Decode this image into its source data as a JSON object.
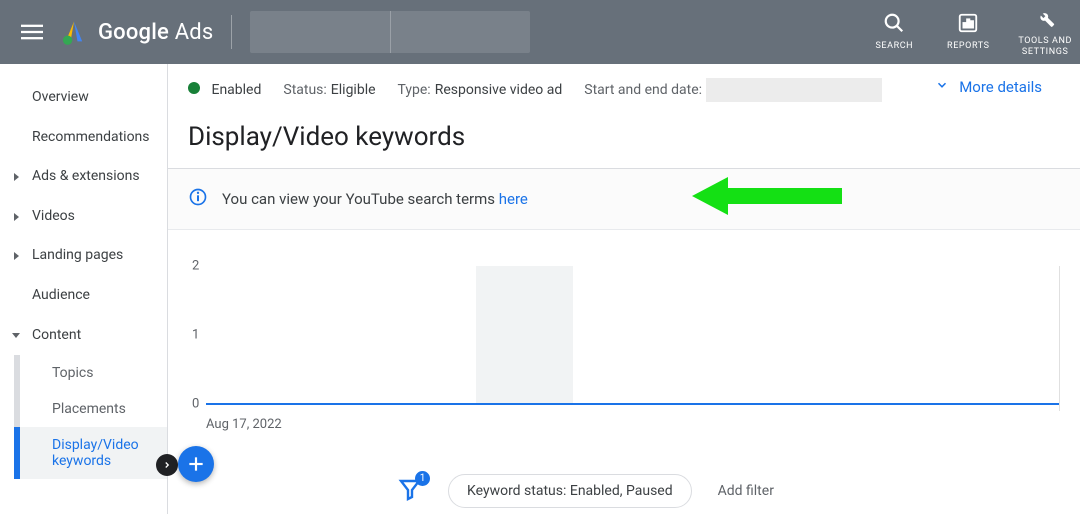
{
  "brand": {
    "name_main": "Google",
    "name_sub": "Ads"
  },
  "top_actions": {
    "search": "SEARCH",
    "reports": "REPORTS",
    "tools": "TOOLS AND\nSETTINGS"
  },
  "sidebar": {
    "overview": "Overview",
    "recommendations": "Recommendations",
    "ads_ext": "Ads & extensions",
    "videos": "Videos",
    "landing": "Landing pages",
    "audience": "Audience",
    "content": "Content",
    "topics": "Topics",
    "placements": "Placements",
    "dvkeywords": "Display/Video keywords"
  },
  "status": {
    "enabled": "Enabled",
    "status_key": "Status:",
    "status_val": "Eligible",
    "type_key": "Type:",
    "type_val": "Responsive video ad",
    "date_key": "Start and end date:",
    "more": "More details"
  },
  "page_title": "Display/Video keywords",
  "notice": {
    "text": "You can view your YouTube search terms ",
    "link": "here"
  },
  "chart_data": {
    "type": "line",
    "title": "",
    "xlabel": "",
    "ylabel": "",
    "ylim": [
      0,
      2
    ],
    "y_ticks": [
      0,
      1,
      2
    ],
    "categories": [
      "Aug 17, 2022"
    ],
    "series": [
      {
        "name": "",
        "values": [
          0
        ]
      }
    ],
    "x_axis_start": "Aug 17, 2022"
  },
  "filter": {
    "badge": "1",
    "chip": "Keyword status: Enabled, Paused",
    "add": "Add filter"
  }
}
